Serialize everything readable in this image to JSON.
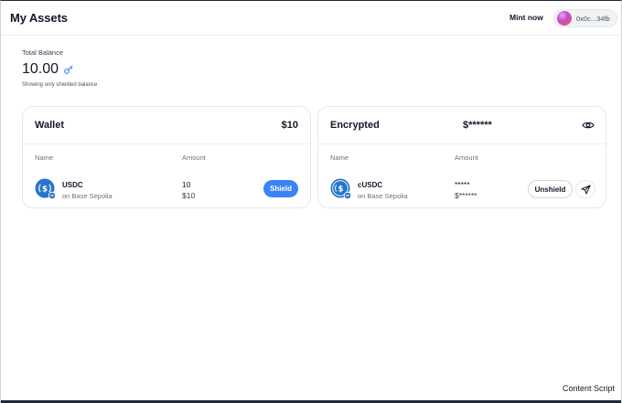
{
  "header": {
    "title": "My Assets",
    "mint_label": "Mint now",
    "wallet_address": "0x0c...34fb"
  },
  "balance": {
    "label": "Total Balance",
    "value": "10.00",
    "note": "Showing only shielded balance"
  },
  "wallet_card": {
    "title": "Wallet",
    "total": "$10",
    "col_name": "Name",
    "col_amount": "Amount",
    "token": {
      "symbol": "USDC",
      "network": "on Base Sepolia",
      "amount": "10",
      "value": "$10",
      "icon": "usdc-icon"
    },
    "action_label": "Shield"
  },
  "encrypted_card": {
    "title": "Encrypted",
    "total": "$******",
    "col_name": "Name",
    "col_amount": "Amount",
    "token": {
      "symbol": "cUSDC",
      "network": "on Base Sepolia",
      "amount": "*****",
      "value": "$******",
      "icon": "cusdc-icon"
    },
    "action_label": "Unshield",
    "send_icon": "send-icon",
    "visibility_icon": "eye-icon"
  },
  "footer": {
    "text": "Content Script"
  },
  "colors": {
    "accent": "#3b82f6",
    "usdc_blue": "#2775ca"
  }
}
